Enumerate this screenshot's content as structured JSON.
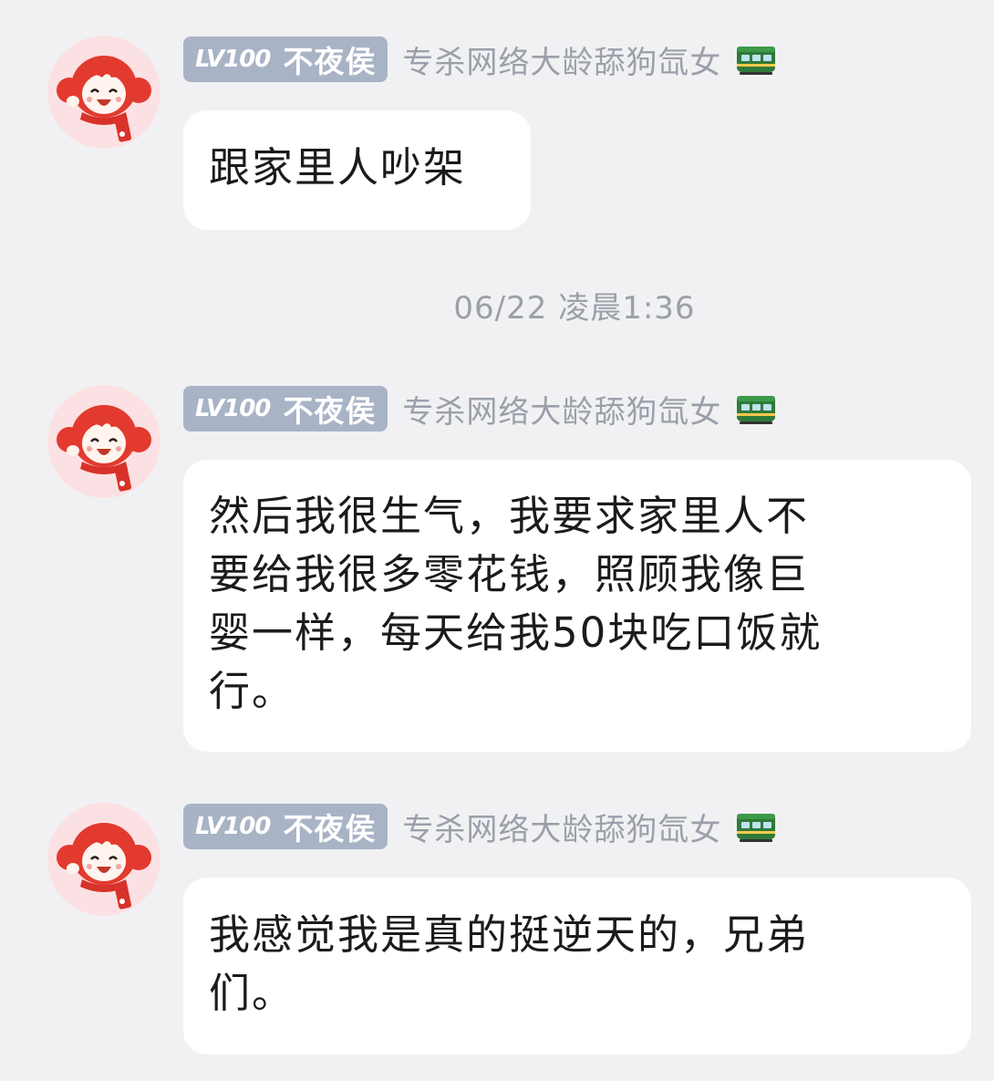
{
  "user": {
    "level": "LV100",
    "title": "不夜侯",
    "name": "专杀网络大龄舔狗氙女",
    "badge_icon": "green-train-icon",
    "avatar": "red-haired-cartoon-girl-avatar"
  },
  "timestamp": "06/22 凌晨1:36",
  "messages": [
    {
      "text": "跟家里人吵架"
    },
    {
      "text": "然后我很生气，我要求家里人不\n要给我很多零花钱，照顾我像巨\n婴一样，每天给我50块吃口饭就\n行。"
    },
    {
      "text": "我感觉我是真的挺逆天的，兄弟\n们。"
    }
  ],
  "colors": {
    "background": "#f1f1f3",
    "bubble": "#ffffff",
    "badge": "#a9b3c6",
    "muted_text": "#9aa0aa",
    "avatar_bg": "#fbe1e3"
  }
}
